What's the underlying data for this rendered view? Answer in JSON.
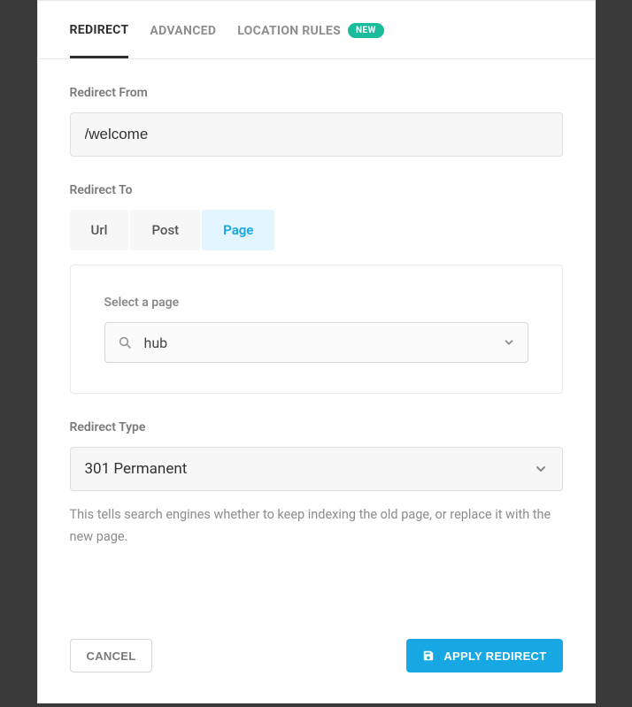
{
  "tabs": {
    "redirect": "REDIRECT",
    "advanced": "ADVANCED",
    "location_rules": "LOCATION RULES",
    "new_badge": "NEW"
  },
  "redirect_from": {
    "label": "Redirect From",
    "value": "/welcome"
  },
  "redirect_to": {
    "label": "Redirect To",
    "options": {
      "url": "Url",
      "post": "Post",
      "page": "Page"
    }
  },
  "page_select": {
    "label": "Select a page",
    "value": "hub"
  },
  "redirect_type": {
    "label": "Redirect Type",
    "value": "301 Permanent",
    "help": "This tells search engines whether to keep indexing the old page, or replace it with the new page."
  },
  "footer": {
    "cancel": "CANCEL",
    "apply": "APPLY REDIRECT"
  }
}
